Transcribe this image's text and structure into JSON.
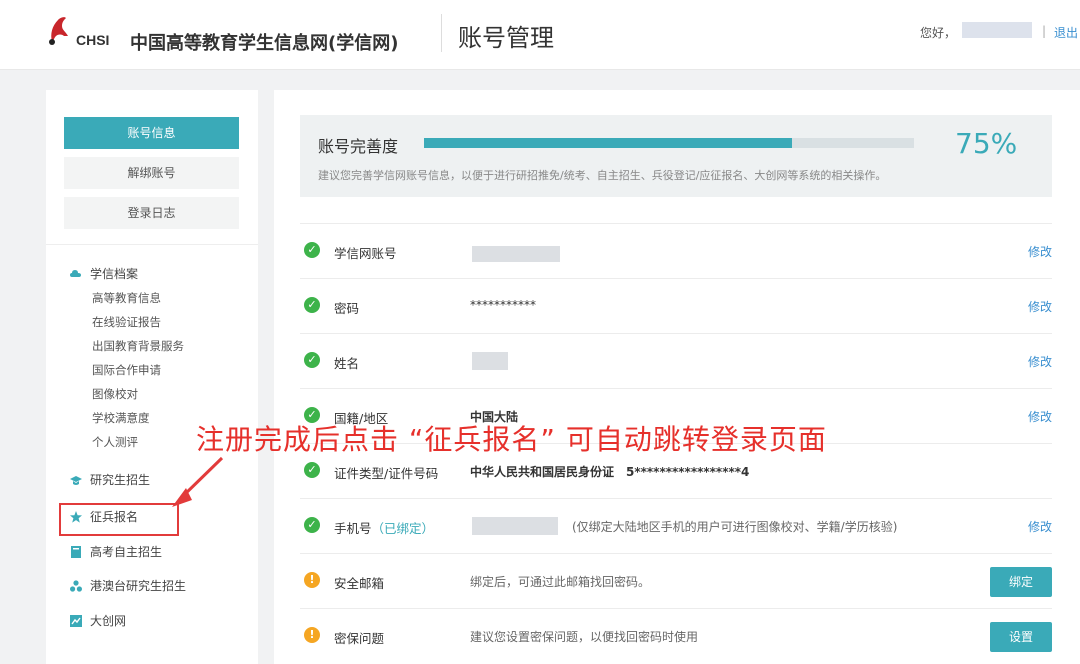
{
  "header": {
    "logo_text": "CHSI",
    "site_name": "中国高等教育学生信息网(学信网)",
    "page_title": "账号管理",
    "greeting": "您好，",
    "separator": "|",
    "logout": "退出"
  },
  "sidebar": {
    "buttons": [
      {
        "label": "账号信息",
        "active": true
      },
      {
        "label": "解绑账号",
        "active": false
      },
      {
        "label": "登录日志",
        "active": false
      }
    ],
    "groups": {
      "archive": {
        "label": "学信档案",
        "icon": "cloud-icon",
        "color": "#3aaab8"
      },
      "graduate": {
        "label": "研究生招生",
        "icon": "graduation-cap-icon",
        "color": "#3aaab8"
      },
      "military": {
        "label": "征兵报名",
        "icon": "star-icon",
        "color": "#3aaab8"
      },
      "gaokao": {
        "label": "高考自主招生",
        "icon": "book-icon",
        "color": "#3aaab8"
      },
      "hkmt": {
        "label": "港澳台研究生招生",
        "icon": "people-icon",
        "color": "#3aaab8"
      },
      "dachuang": {
        "label": "大创网",
        "icon": "chart-icon",
        "color": "#3aaab8"
      }
    },
    "archive_items": [
      "高等教育信息",
      "在线验证报告",
      "出国教育背景服务",
      "国际合作申请",
      "图像校对",
      "学校满意度",
      "个人测评"
    ]
  },
  "annotation": "注册完成后点击 “征兵报名” 可自动跳转登录页面",
  "annotation_color": "#e6302b",
  "progress": {
    "label": "账号完善度",
    "percent_text": "75%",
    "percent": 75,
    "hint": "建议您完善学信网账号信息，以便于进行研招推免/统考、自主招生、兵役登记/应征报名、大创网等系统的相关操作。"
  },
  "rows": {
    "account": {
      "label": "学信网账号",
      "edit": "修改",
      "status": "ok"
    },
    "password": {
      "label": "密码",
      "value": "***********",
      "edit": "修改",
      "status": "ok"
    },
    "name": {
      "label": "姓名",
      "edit": "修改",
      "status": "ok"
    },
    "nationality": {
      "label": "国籍/地区",
      "value": "中国大陆",
      "edit": "修改",
      "status": "ok"
    },
    "id": {
      "label": "证件类型/证件号码",
      "value": "中华人民共和国居民身份证　5*****************4",
      "status": "ok"
    },
    "phone": {
      "label": "手机号",
      "bound": "（已绑定）",
      "note": "(仅绑定大陆地区手机的用户可进行图像校对、学籍/学历核验)",
      "edit": "修改",
      "status": "ok"
    },
    "email": {
      "label": "安全邮箱",
      "note": "绑定后，可通过此邮箱找回密码。",
      "button": "绑定",
      "status": "warn"
    },
    "security": {
      "label": "密保问题",
      "note": "建议您设置密保问题，以便找回密码时使用",
      "button": "设置",
      "status": "warn"
    }
  },
  "colors": {
    "accent": "#3aaab8",
    "link": "#3a8fd0",
    "ok": "#3db34a",
    "warn": "#f5a623",
    "highlight": "#e23b3b"
  }
}
